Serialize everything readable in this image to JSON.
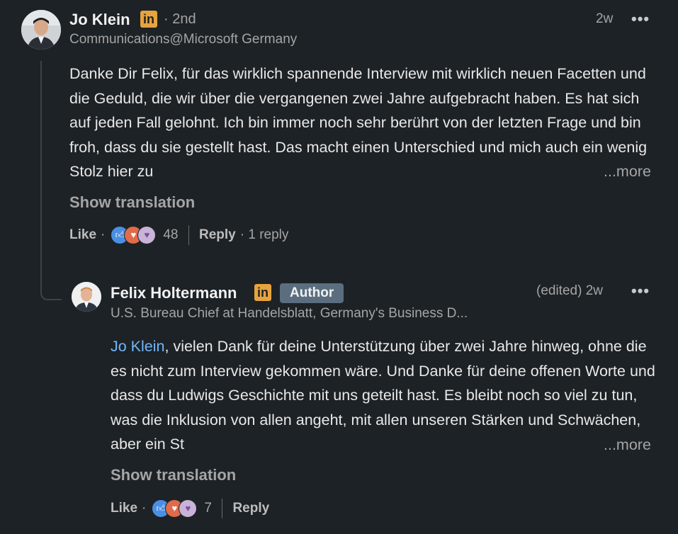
{
  "comment": {
    "author": "Jo Klein",
    "degree": "· 2nd",
    "headline": "Communications@Microsoft Germany",
    "time": "2w",
    "body": "Danke Dir Felix, für das wirklich spannende Interview mit wirklich neuen Facetten und die Geduld, die wir über die vergangenen zwei Jahre aufgebracht haben. Es hat sich auf jeden Fall gelohnt. Ich bin immer noch sehr berührt von der letzten Frage und bin froh, dass du sie gestellt hast. Das macht einen Unterschied und mich auch ein wenig Stolz hier zu",
    "more": "...more",
    "show_translation": "Show translation",
    "like": "Like",
    "reaction_count": "48",
    "reply": "Reply",
    "reply_count": "· 1 reply"
  },
  "reply": {
    "author": "Felix Holtermann",
    "badge": "Author",
    "headline": "U.S. Bureau Chief at Handelsblatt, Germany's Business D...",
    "time": "(edited) 2w",
    "mention": "Jo Klein",
    "body": ", vielen Dank für deine Unterstützung über zwei Jahre hinweg, ohne die es nicht zum Interview gekommen wäre. Und Danke für deine offenen Worte und dass du Ludwigs Geschichte mit uns geteilt hast. Es bleibt noch so viel zu tun, was die Inklusion von allen angeht, mit allen unseren Stärken und Schwächen, aber ein St",
    "more": "...more",
    "show_translation": "Show translation",
    "like": "Like",
    "reaction_count": "7",
    "reply": "Reply"
  },
  "icons": {
    "linkedin_badge": "in",
    "overflow": "•••",
    "dot": "·"
  },
  "colors": {
    "background": "#1d2226",
    "linkedin_badge": "#e7a33e",
    "mention": "#71b7fb",
    "author_badge": "#5a6e80"
  }
}
